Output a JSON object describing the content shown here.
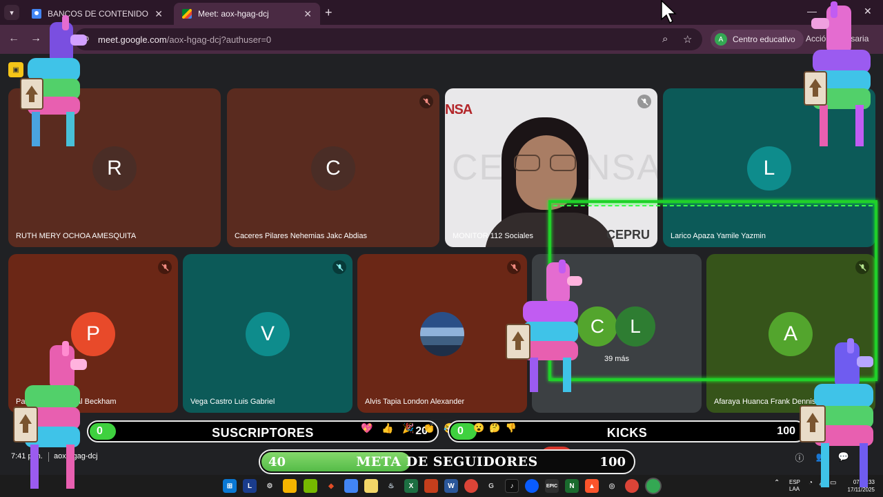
{
  "browser": {
    "tabs": [
      {
        "title": "BANCOS DE CONTENIDO DIGIT",
        "favicon": "google-docs-icon"
      },
      {
        "title": "Meet: aox-hgag-dcj",
        "favicon": "google-meet-icon",
        "active": true
      }
    ],
    "url_host": "meet.google.com",
    "url_path": "/aox-hgag-dcj?authuser=0",
    "profile_initial": "A",
    "profile_label": "Centro educativo",
    "account_action": "Acción necesaria",
    "theme_color": "#4a2a43"
  },
  "meet": {
    "tiles_row1": [
      {
        "initial": "R",
        "name": "RUTH MERY OCHOA AMESQUITA",
        "bg": "#5a2b1f",
        "avatar_bg": "#4a2d26",
        "muted": false
      },
      {
        "initial": "C",
        "name": "Caceres Pilares Nehemias Jakc Abdias",
        "bg": "#5a2b1f",
        "avatar_bg": "#4a2d26",
        "muted": true
      },
      {
        "name": "MONITOR 112 Sociales",
        "video": true,
        "muted": true,
        "logo_text": "NSA",
        "bg_text": "CEPRUNSA",
        "shirt_text": "CEPRU"
      },
      {
        "initial": "L",
        "name": "Larico Apaza Yamile Yazmin",
        "bg": "#0c5a58",
        "avatar_bg": "#0e8c8c",
        "muted": false
      }
    ],
    "tiles_row2": [
      {
        "initial": "P",
        "name": "Palma Ticona Geral Beckham",
        "bg": "#6b2716",
        "avatar_bg": "#e84a2a",
        "muted": true
      },
      {
        "initial": "V",
        "name": "Vega Castro Luis Gabriel",
        "bg": "#0c5a58",
        "avatar_bg": "#0e8c8c",
        "muted": true
      },
      {
        "name": "Alvis Tapia London Alexander",
        "bg": "#6b2716",
        "photo": "mountain-photo-avatar",
        "muted": true
      },
      {
        "more_initials": [
          "C",
          "L"
        ],
        "more_label": "39 más",
        "bg": "#3c4043"
      },
      {
        "initial": "A",
        "name": "Afaraya Huanca Frank Dennis",
        "bg": "#36541a",
        "avatar_bg": "#53a52d",
        "muted": true
      }
    ],
    "meeting_time": "7:41 p.m.",
    "meeting_code": "aox-hgag-dcj"
  },
  "overlay": {
    "subs": {
      "value": "0",
      "label": "SUSCRIPTORES",
      "goal": "20"
    },
    "kicks": {
      "value": "0",
      "label": "KICKS",
      "goal": "100"
    },
    "followers": {
      "value": "40",
      "label": "META DE SEGUIDORES",
      "goal": "100"
    },
    "frame_color": "#20d02a"
  },
  "taskbar": {
    "lang": "ESP",
    "lang2": "LAA",
    "time": "07:41:33",
    "date": "17/11/2025"
  }
}
